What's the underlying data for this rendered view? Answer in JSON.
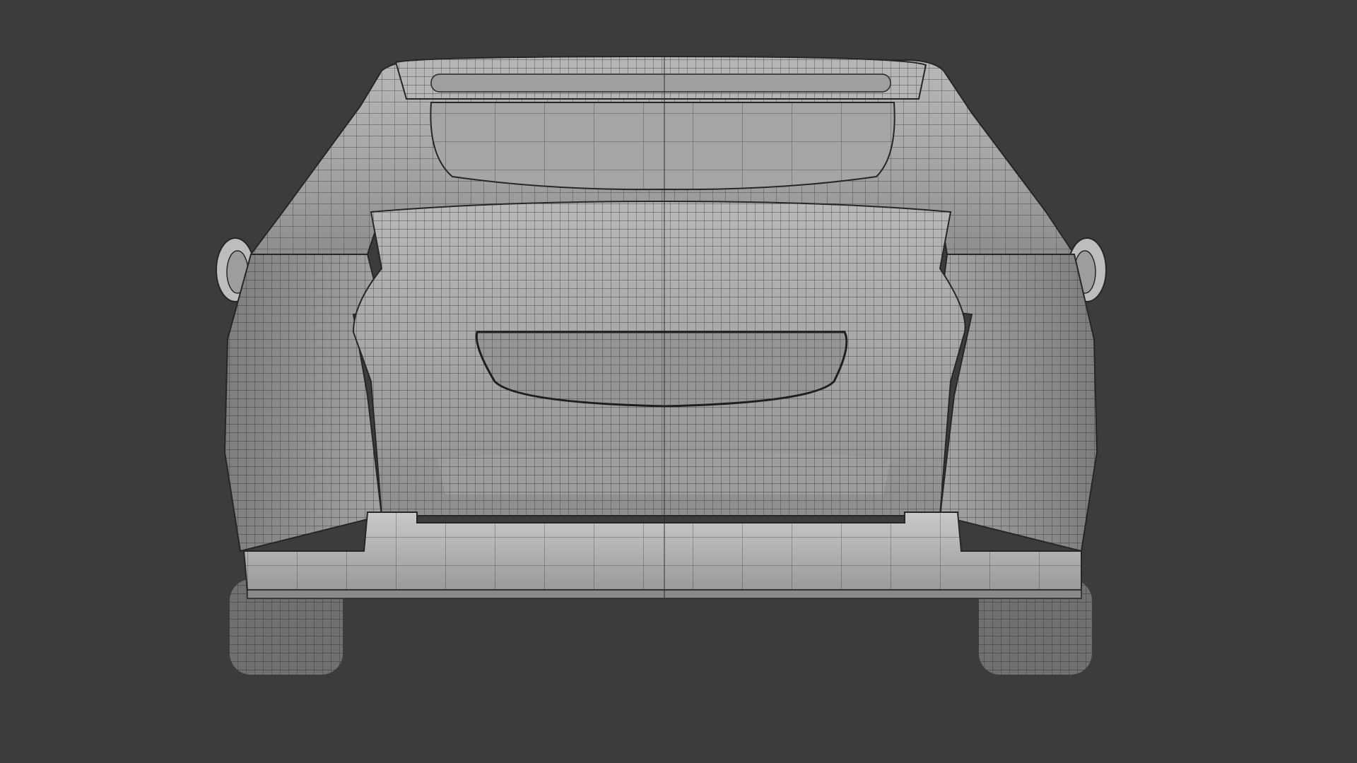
{
  "viewport": {
    "background_color": "#3c3c3c",
    "subject": "car-rear-wireframe",
    "shading": "solid-with-wireframe",
    "visible_text": ""
  },
  "palette": {
    "body": "#a9a9a9",
    "body_light": "#c4c4c4",
    "body_dark": "#7a7a7a",
    "wire": "#262626",
    "tire": "#6e6e6e"
  }
}
